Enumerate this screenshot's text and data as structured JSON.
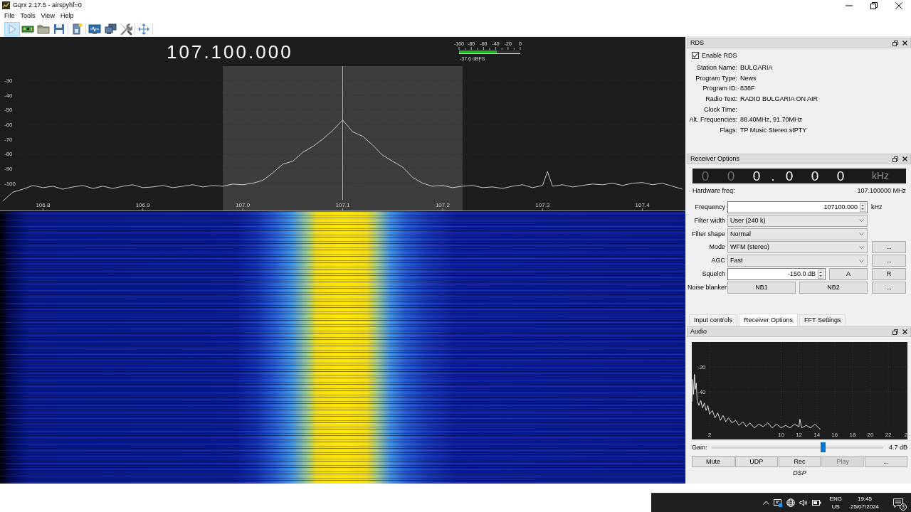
{
  "window": {
    "title": "Gqrx 2.17.5 - airspyhf=0"
  },
  "menu": [
    "File",
    "Tools",
    "View",
    "Help"
  ],
  "toolbar": [
    {
      "pressed": true
    },
    {
      "pressed": false
    },
    {
      "pressed": false
    },
    {
      "pressed": false
    },
    {
      "pressed": false
    },
    {
      "pressed": false
    },
    {
      "pressed": false
    },
    {
      "pressed": false
    },
    {
      "pressed": false
    }
  ],
  "spectrum": {
    "frequency": "107.100.000",
    "meter": {
      "scale": [
        "-100",
        "-80",
        "-60",
        "-40",
        "-20",
        "0"
      ],
      "level": 0.62,
      "reading": "-37.6 dBFS"
    },
    "chart_data": {
      "type": "line",
      "color": "#f2f2f2",
      "grid": true,
      "xlim": [
        106.757,
        107.443
      ],
      "ylim": [
        -119,
        -0.5
      ],
      "xticks": [
        106.8,
        106.9,
        {
          "value": 107,
          "label": "107.0"
        },
        107.1,
        107.2,
        107.3,
        107.4
      ],
      "yticks": [
        -30,
        -40,
        -50,
        -60,
        -70,
        -80,
        -90,
        -100
      ],
      "bands": [
        {
          "axis": "x",
          "from": 106.98,
          "to": 107.22,
          "color": "#3d3d3d"
        }
      ],
      "ref_lines": [
        {
          "axis": "x",
          "value": 107.1,
          "color": "#b0b0b0"
        }
      ],
      "x": [
        106.76,
        106.77,
        106.78,
        106.79,
        106.8,
        106.81,
        106.82,
        106.83,
        106.84,
        106.85,
        106.86,
        106.87,
        106.88,
        106.89,
        106.9,
        106.91,
        106.92,
        106.93,
        106.94,
        106.95,
        106.96,
        106.97,
        106.98,
        106.99,
        107,
        107.01,
        107.02,
        107.03,
        107.04,
        107.05,
        107.06,
        107.07,
        107.08,
        107.09,
        107.1,
        107.11,
        107.12,
        107.13,
        107.14,
        107.15,
        107.16,
        107.17,
        107.18,
        107.19,
        107.2,
        107.21,
        107.22,
        107.23,
        107.24,
        107.25,
        107.26,
        107.27,
        107.28,
        107.29,
        107.3,
        107.305,
        107.31,
        107.32,
        107.33,
        107.34,
        107.35,
        107.36,
        107.37,
        107.38,
        107.39,
        107.4,
        107.41,
        107.42,
        107.43,
        107.44
      ],
      "values": [
        -112,
        -106,
        -104,
        -101.5,
        -103,
        -102,
        -104,
        -102.5,
        -101.5,
        -103.5,
        -102,
        -103.5,
        -102,
        -101,
        -103,
        -102.5,
        -101.5,
        -103,
        -102,
        -101,
        -102.5,
        -101.5,
        -102,
        -100.5,
        -101,
        -100,
        -98,
        -93,
        -87,
        -85,
        -79,
        -75,
        -70,
        -64,
        -57,
        -65,
        -68,
        -74,
        -81,
        -85,
        -89,
        -96,
        -100,
        -102,
        -101.5,
        -103,
        -102,
        -101.5,
        -103,
        -102.5,
        -103.5,
        -102,
        -101,
        -103,
        -101.5,
        -92,
        -102,
        -101,
        -102.5,
        -101.5,
        -100.5,
        -101,
        -100,
        -101.5,
        -100,
        -99.5,
        -101,
        -100,
        -102,
        -104
      ]
    }
  },
  "rds": {
    "title": "RDS",
    "enable": {
      "label": "Enable RDS",
      "checked": true
    },
    "fields": [
      {
        "label": "Station Name:",
        "value": "BULGARIA"
      },
      {
        "label": "Program Type:",
        "value": "News"
      },
      {
        "label": "Program ID:",
        "value": "838F"
      },
      {
        "label": "Radio Text:",
        "value": "RADIO BULGARIA ON AIR"
      },
      {
        "label": "Clock Time:"
      },
      {
        "label": "Alt. Frequencies:",
        "value": "88.40MHz, 91.70MHz"
      },
      {
        "label": "Flags:",
        "value": "TP Music Stereo stPTY"
      }
    ]
  },
  "receiver_options": {
    "title": "Receiver Options",
    "lcd": {
      "digits": [
        {
          "kind": "digit",
          "text": "0",
          "dim": true
        },
        {
          "kind": "digit",
          "text": "0",
          "dim": true
        },
        {
          "kind": "digit",
          "text": "0",
          "dim": false
        },
        {
          "kind": "separator",
          "text": ".",
          "dim": false
        },
        {
          "kind": "digit",
          "text": "0",
          "dim": false
        },
        {
          "kind": "digit",
          "text": "0",
          "dim": false
        },
        {
          "kind": "digit",
          "text": "0",
          "dim": false
        }
      ],
      "unit": "kHz"
    },
    "hardware_freq": {
      "label": "Hardware freq:",
      "value": "107.100000 MHz"
    },
    "rows": [
      {
        "label": "Frequency",
        "kind": "spin",
        "value": "107100.000",
        "unit": "kHz"
      },
      {
        "label": "Filter width",
        "kind": "combo",
        "value": "User (240 k)"
      },
      {
        "label": "Filter shape",
        "kind": "combo",
        "value": "Normal"
      },
      {
        "label": "Mode",
        "kind": "combo",
        "value": "WFM (stereo)",
        "buttons": [
          "..."
        ]
      },
      {
        "label": "AGC",
        "kind": "combo",
        "value": "Fast",
        "buttons": [
          "..."
        ]
      },
      {
        "label": "Squelch",
        "kind": "spin",
        "value": "-150.0 dB",
        "buttons": [
          "A",
          "R"
        ]
      },
      {
        "label": "Noise blanker",
        "kind": "buttons",
        "buttons": [
          "NB1",
          "NB2",
          "..."
        ]
      }
    ]
  },
  "tabs": [
    {
      "label": "Input controls",
      "selected": false
    },
    {
      "label": "Receiver Options",
      "selected": true
    },
    {
      "label": "FFT Settings",
      "selected": false
    }
  ],
  "audio": {
    "title": "Audio",
    "chart_data": {
      "type": "line",
      "color": "#f0f0f0",
      "grid": true,
      "xlim": [
        0,
        24.14
      ],
      "ylim": [
        -78.3,
        0
      ],
      "xticks": [
        2,
        10,
        12,
        14,
        16,
        18,
        20,
        22
      ],
      "yticks": [
        -20,
        -40
      ],
      "x": [
        0,
        0.1,
        0.2,
        0.3,
        0.4,
        0.5,
        0.6,
        0.8,
        1,
        1.2,
        1.4,
        1.6,
        1.8,
        2,
        2.3,
        2.6,
        2.9,
        3.2,
        3.5,
        3.8,
        4.1,
        4.5,
        4.9,
        5.3,
        5.7,
        6.1,
        6.5,
        7,
        7.5,
        8,
        8.5,
        9,
        9.5,
        10,
        10.5,
        11,
        11.5,
        12,
        12.1,
        12.3,
        12.8,
        13.3,
        13.8,
        14.2,
        14.4
      ],
      "values": [
        -48,
        -30,
        -42,
        -26,
        -38,
        -33,
        -47,
        -51,
        -47,
        -53,
        -49,
        -55,
        -51,
        -58,
        -55,
        -61,
        -57,
        -63,
        -59,
        -64,
        -61,
        -65,
        -63,
        -67,
        -64,
        -68,
        -65,
        -69,
        -66,
        -68,
        -65,
        -69,
        -66,
        -69,
        -67,
        -69,
        -66,
        -68,
        -62,
        -69,
        -67,
        -69,
        -66,
        -69,
        -70
      ]
    },
    "cut_tick_label": "2",
    "gain": {
      "label": "Gain:",
      "level": 0.65,
      "reading": "4.7 dB"
    },
    "buttons": [
      {
        "label": "Mute",
        "disabled": false
      },
      {
        "label": "UDP",
        "disabled": false
      },
      {
        "label": "Rec",
        "disabled": false
      },
      {
        "label": "Play",
        "disabled": true
      },
      {
        "label": "...",
        "disabled": false
      }
    ],
    "footer": "DSP"
  },
  "taskbar": {
    "language": "ENG",
    "region": "US",
    "time": "19:45",
    "date": "25/07/2024",
    "notifications": "3"
  }
}
